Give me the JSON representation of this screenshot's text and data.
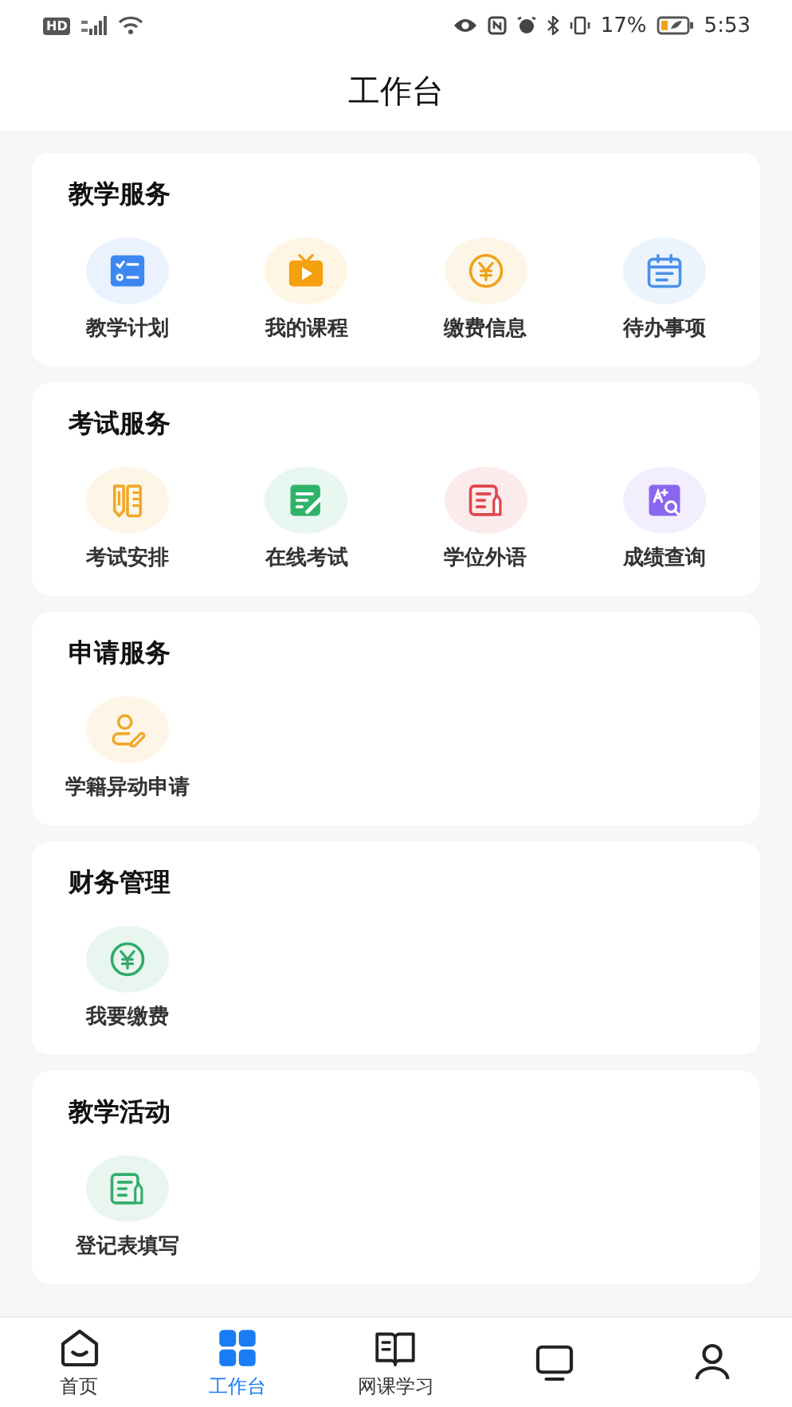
{
  "status_bar": {
    "badge": "HD",
    "battery": "17%",
    "time": "5:53"
  },
  "header": {
    "title": "工作台"
  },
  "sections": [
    {
      "title": "教学服务",
      "items": [
        {
          "label": "教学计划",
          "kind": "checklist",
          "color": "#3d87f2"
        },
        {
          "label": "我的课程",
          "kind": "tv",
          "color": "#f5a00f"
        },
        {
          "label": "缴费信息",
          "kind": "yuan",
          "color": "#eea21a"
        },
        {
          "label": "待办事项",
          "kind": "calendar",
          "color": "#4a90e8"
        }
      ]
    },
    {
      "title": "考试服务",
      "items": [
        {
          "label": "考试安排",
          "kind": "ruler",
          "color": "#f0a928"
        },
        {
          "label": "在线考试",
          "kind": "note",
          "color": "#2fb36b"
        },
        {
          "label": "学位外语",
          "kind": "docpen",
          "color": "#e0464c"
        },
        {
          "label": "成绩查询",
          "kind": "grade",
          "color": "#8a67ee"
        }
      ]
    },
    {
      "title": "申请服务",
      "items": [
        {
          "label": "学籍异动申请",
          "kind": "person",
          "color": "#eeaa2c"
        }
      ]
    },
    {
      "title": "财务管理",
      "items": [
        {
          "label": "我要缴费",
          "kind": "yuan",
          "color": "#2faa6a"
        }
      ]
    },
    {
      "title": "教学活动",
      "items": [
        {
          "label": "登记表填写",
          "kind": "docpen",
          "color": "#35ad6e"
        }
      ]
    }
  ],
  "tab_bar": [
    {
      "label": "首页",
      "kind": "home",
      "selected": false
    },
    {
      "label": "工作台",
      "kind": "grid",
      "selected": true
    },
    {
      "label": "网课学习",
      "kind": "book",
      "selected": false
    },
    {
      "kind": "screen",
      "selected": false
    },
    {
      "kind": "user",
      "selected": false
    }
  ]
}
